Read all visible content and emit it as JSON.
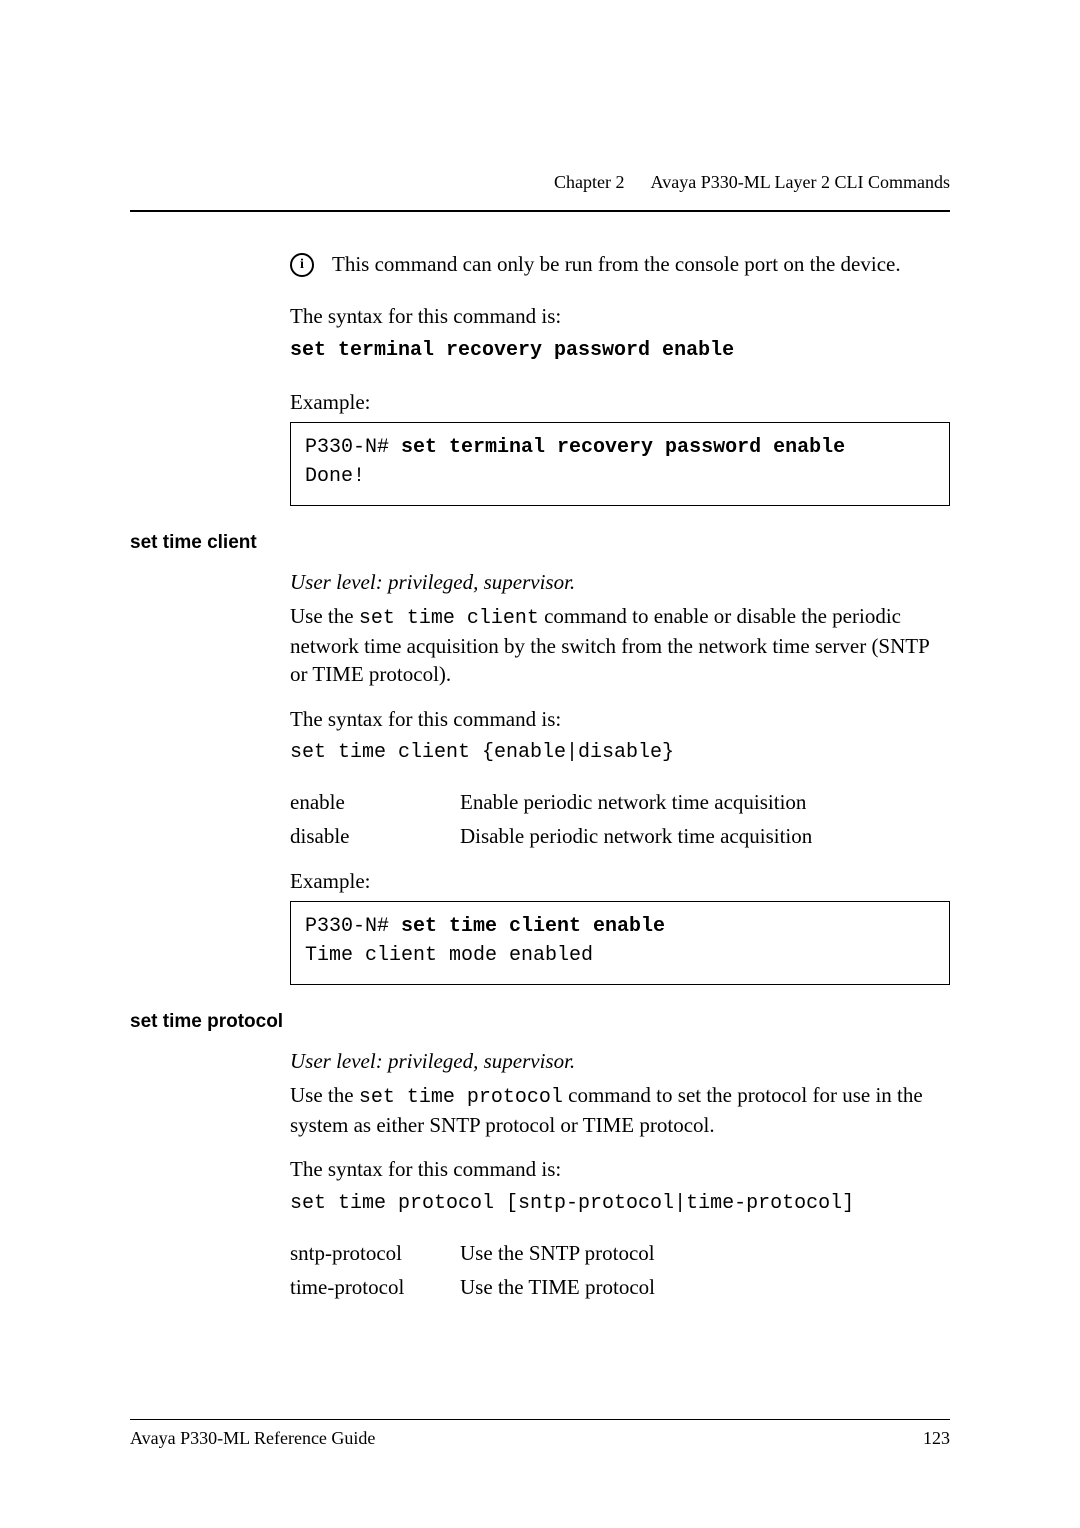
{
  "running_head": {
    "chapter": "Chapter 2",
    "title": "Avaya P330-ML Layer 2 CLI Commands"
  },
  "intro": {
    "info_note": "This command can only be run from the console port on the device.",
    "syntax_label": "The syntax for this command is:",
    "syntax_cmd": "set terminal recovery password enable",
    "example_label": "Example:",
    "example_prompt": "P330-N# ",
    "example_cmd": "set terminal recovery password enable",
    "example_out": "Done!"
  },
  "sec1": {
    "heading": "set time client",
    "level": "User level: privileged, supervisor.",
    "desc_pre": "Use the ",
    "desc_cmd": "set time client",
    "desc_post": " command to enable or disable the periodic network time acquisition by the switch from the network time server (SNTP or TIME protocol).",
    "syntax_label": "The syntax for this command is:",
    "syntax_cmd": "set time client {enable|disable}",
    "params": [
      {
        "key": "enable",
        "desc": "Enable periodic network time acquisition"
      },
      {
        "key": "disable",
        "desc": "Disable periodic network time acquisition"
      }
    ],
    "example_label": "Example:",
    "example_prompt": "P330-N# ",
    "example_cmd": "set time client enable",
    "example_out": "Time client mode enabled"
  },
  "sec2": {
    "heading": "set time protocol",
    "level": "User level: privileged, supervisor.",
    "desc_pre": "Use the ",
    "desc_cmd": "set time protocol",
    "desc_post": " command to set the protocol for use in the system as either SNTP protocol or TIME protocol.",
    "syntax_label": "The syntax for this command is:",
    "syntax_cmd": "set time protocol  [sntp-protocol|time-protocol]",
    "params": [
      {
        "key": "sntp-protocol",
        "desc": "Use the SNTP protocol"
      },
      {
        "key": "time-protocol",
        "desc": "Use the TIME protocol"
      }
    ]
  },
  "footer": {
    "left": "Avaya P330-ML Reference Guide",
    "right": "123"
  }
}
